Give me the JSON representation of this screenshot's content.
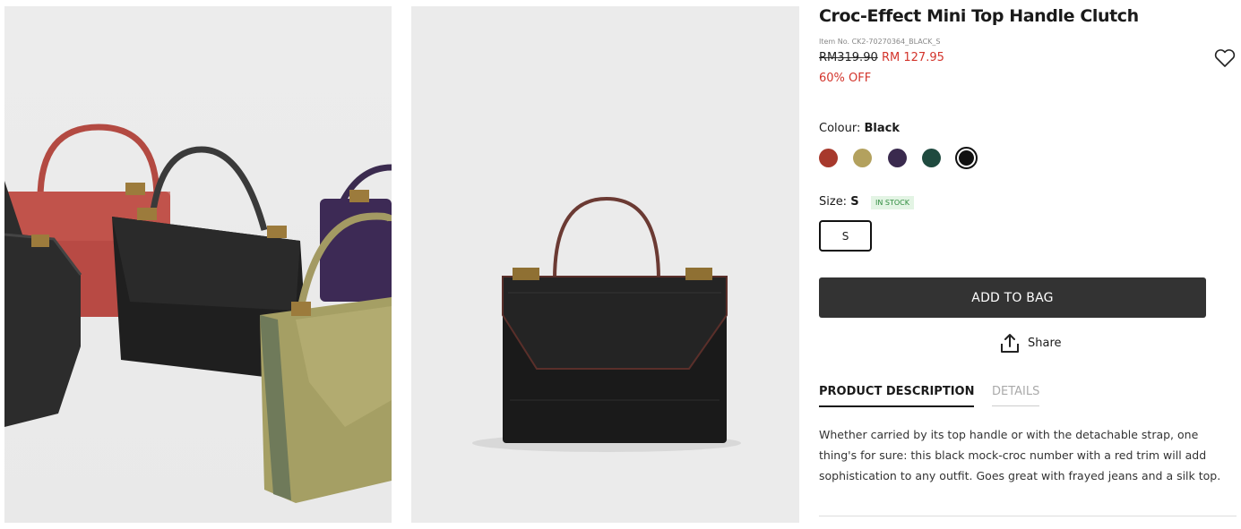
{
  "product": {
    "title": "Croc-Effect Mini Top Handle Clutch",
    "item_no": "Item No. CK2-70270364_BLACK_S",
    "original_price": "RM319.90",
    "sale_price": "RM 127.95",
    "discount": "60% OFF"
  },
  "colour": {
    "label": "Colour:",
    "selected": "Black",
    "swatches": [
      {
        "name": "Red",
        "hex": "#a7392c"
      },
      {
        "name": "Khaki",
        "hex": "#b3a15e"
      },
      {
        "name": "Purple",
        "hex": "#3a2a4e"
      },
      {
        "name": "Green",
        "hex": "#1f4a3f"
      },
      {
        "name": "Black",
        "hex": "#111111"
      }
    ]
  },
  "size": {
    "label": "Size:",
    "selected": "S",
    "stock": "IN STOCK",
    "options": [
      "S"
    ]
  },
  "actions": {
    "add_to_bag": "ADD TO BAG",
    "share": "Share"
  },
  "tabs": {
    "description": "PRODUCT DESCRIPTION",
    "details": "DETAILS"
  },
  "description": "Whether carried by its top handle or with the detachable strap, one thing's for sure: this black mock-croc number with a red trim will add sophistication to any outfit. Goes great with frayed jeans and a silk top.",
  "icons": {
    "wishlist": "heart-icon",
    "share": "share-upload-icon"
  },
  "colors": {
    "accent_price": "#d3352c",
    "button_bg": "#333333",
    "stock_green": "#2e8b3d"
  }
}
